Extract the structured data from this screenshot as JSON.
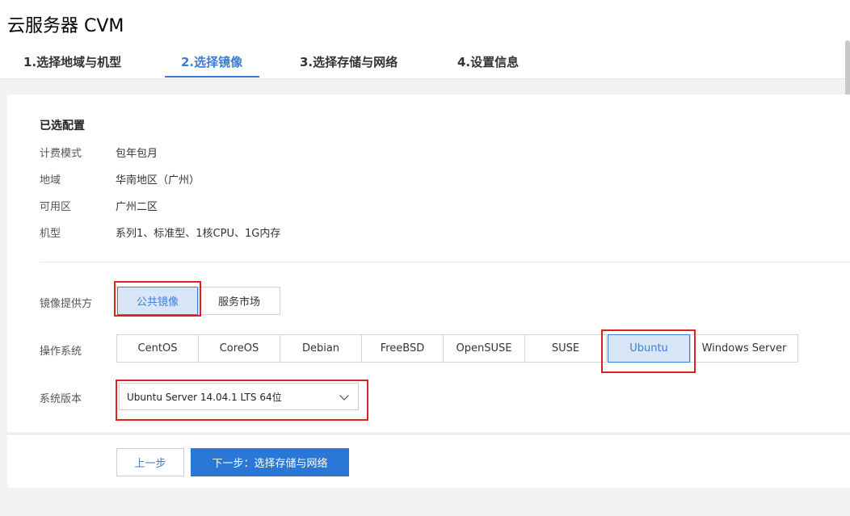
{
  "page": {
    "title": "云服务器 CVM"
  },
  "steps": [
    {
      "label": "1.选择地域与机型"
    },
    {
      "label": "2.选择镜像"
    },
    {
      "label": "3.选择存储与网络"
    },
    {
      "label": "4.设置信息"
    }
  ],
  "selected_config": {
    "title": "已选配置",
    "rows": [
      {
        "label": "计费模式",
        "value": "包年包月"
      },
      {
        "label": "地域",
        "value": "华南地区（广州）"
      },
      {
        "label": "可用区",
        "value": "广州二区"
      },
      {
        "label": "机型",
        "value": "系列1、标准型、1核CPU、1G内存"
      }
    ]
  },
  "image_provider": {
    "label": "镜像提供方",
    "options": [
      "公共镜像",
      "服务市场"
    ],
    "selected": "公共镜像"
  },
  "os": {
    "label": "操作系统",
    "options": [
      "CentOS",
      "CoreOS",
      "Debian",
      "FreeBSD",
      "OpenSUSE",
      "SUSE",
      "Ubuntu",
      "Windows Server"
    ],
    "selected": "Ubuntu"
  },
  "version": {
    "label": "系统版本",
    "value": "Ubuntu Server 14.04.1 LTS 64位"
  },
  "footer": {
    "prev_label": "上一步",
    "next_label": "下一步：选择存储与网络"
  },
  "colors": {
    "accent": "#3b7cd8",
    "primary_button": "#2a78d6",
    "highlight_box": "#e02020"
  }
}
